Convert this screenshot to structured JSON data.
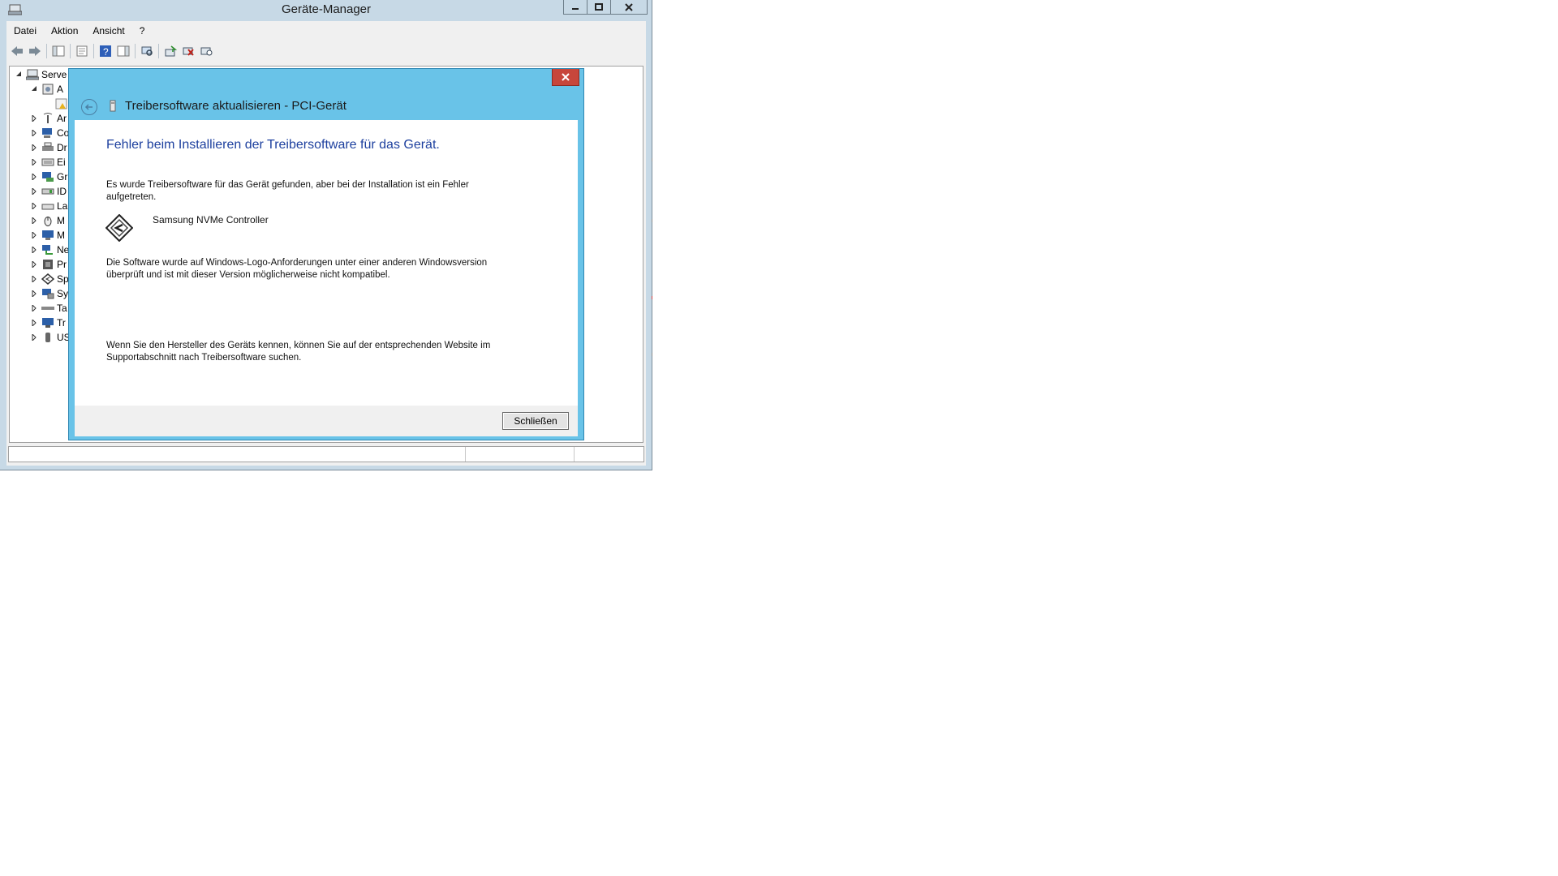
{
  "window": {
    "title": "Geräte-Manager"
  },
  "menu": {
    "items": [
      "Datei",
      "Aktion",
      "Ansicht",
      "?"
    ]
  },
  "tree": {
    "root_label": "Serve",
    "child_label": "A",
    "categories": [
      "Ar",
      "Co",
      "Dr",
      "Ei",
      "Gr",
      "ID",
      "La",
      "M",
      "M",
      "Ne",
      "Pr",
      "Sp",
      "Sy",
      "Ta",
      "Tr",
      "US"
    ]
  },
  "wizard": {
    "title": "Treibersoftware aktualisieren - PCI-Gerät",
    "heading": "Fehler beim Installieren der Treibersoftware für das Gerät.",
    "para1_line1": "Es wurde Treibersoftware für das Gerät gefunden, aber bei der Installation ist ein Fehler",
    "para1_line2": "aufgetreten.",
    "device_name": "Samsung NVMe Controller",
    "para2_line1": "Die Software wurde auf Windows-Logo-Anforderungen unter einer anderen Windowsversion",
    "para2_line2": "überprüft und ist mit dieser Version möglicherweise nicht kompatibel.",
    "para3_line1": "Wenn Sie den Hersteller des Geräts kennen, können Sie auf der entsprechenden Website im",
    "para3_line2": "Supportabschnitt nach Treibersoftware suchen.",
    "close_label": "Schließen"
  },
  "colors": {
    "window_frame": "#c7d9e6",
    "dialog_frame": "#69c3e8",
    "heading_blue": "#1c3f9e",
    "close_red": "#c7463b"
  }
}
